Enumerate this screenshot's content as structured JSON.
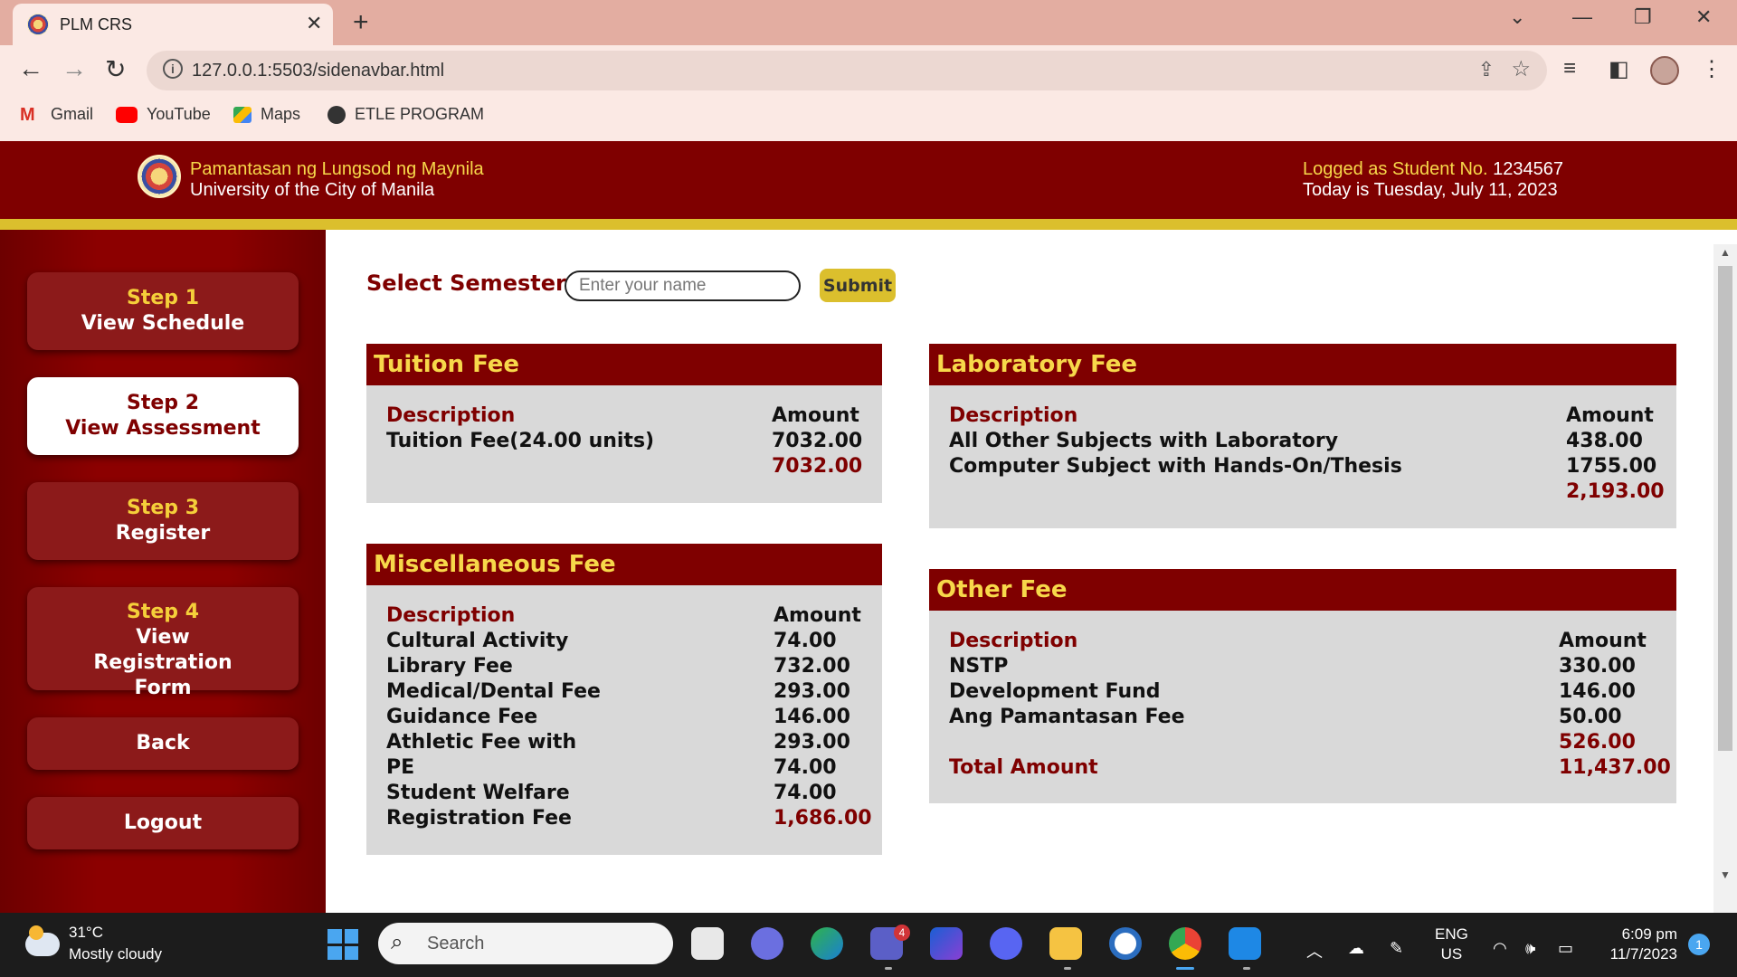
{
  "browser": {
    "tab_title": "PLM CRS",
    "close_glyph": "✕",
    "newtab_glyph": "+",
    "url": "127.0.0.1:5503/sidenavbar.html",
    "bookmarks": [
      {
        "label": "Gmail",
        "icon": "gmail-icon"
      },
      {
        "label": "YouTube",
        "icon": "youtube-icon"
      },
      {
        "label": "Maps",
        "icon": "maps-icon"
      },
      {
        "label": "ETLE PROGRAM",
        "icon": "globe-icon"
      }
    ]
  },
  "header": {
    "university_name": "Pamantasan ng Lungsod ng Maynila",
    "university_subtitle": "University of the City of Manila",
    "logged_prefix": "Logged as Student No.",
    "student_no": "1234567",
    "today_text": "Today is Tuesday, July 11, 2023"
  },
  "sidebar": {
    "steps": [
      {
        "step": "Step 1",
        "label": "View Schedule"
      },
      {
        "step": "Step 2",
        "label": "View Assessment"
      },
      {
        "step": "Step 3",
        "label": "Register"
      },
      {
        "step": "Step 4",
        "label": "View Registration Form"
      }
    ],
    "back": "Back",
    "logout": "Logout"
  },
  "semester": {
    "label": "Select Semester:",
    "placeholder": "Enter your name",
    "value": "",
    "submit": "Submit"
  },
  "fees": {
    "desc_header": "Description",
    "amount_header": "Amount",
    "tuition": {
      "title": "Tuition Fee",
      "rows": [
        {
          "desc": "Tuition Fee(24.00 units)",
          "amount": "7032.00"
        }
      ],
      "subtotal": "7032.00"
    },
    "laboratory": {
      "title": "Laboratory Fee",
      "rows": [
        {
          "desc": "All Other Subjects with Laboratory",
          "amount": "438.00"
        },
        {
          "desc": "Computer Subject with Hands-On/Thesis",
          "amount": "1755.00"
        }
      ],
      "subtotal": "2,193.00"
    },
    "miscellaneous": {
      "title": "Miscellaneous Fee",
      "rows": [
        {
          "desc": "Cultural Activity",
          "amount": "74.00"
        },
        {
          "desc": "Library Fee",
          "amount": "732.00"
        },
        {
          "desc": "Medical/Dental Fee",
          "amount": "293.00"
        },
        {
          "desc": "Guidance Fee",
          "amount": "146.00"
        },
        {
          "desc": "Athletic Fee with",
          "amount": "293.00"
        },
        {
          "desc": "PE",
          "amount": "74.00"
        },
        {
          "desc": "Student Welfare",
          "amount": "74.00"
        }
      ],
      "last_row": {
        "desc": "Registration Fee",
        "amount": "1,686.00"
      }
    },
    "other": {
      "title": "Other Fee",
      "rows": [
        {
          "desc": "NSTP",
          "amount": "330.00"
        },
        {
          "desc": "Development Fund",
          "amount": "146.00"
        },
        {
          "desc": "Ang Pamantasan Fee",
          "amount": "50.00"
        }
      ],
      "subtotal": "526.00",
      "total_label": "Total Amount",
      "total_amount": "11,437.00"
    }
  },
  "taskbar": {
    "temperature": "31°C",
    "condition": "Mostly cloudy",
    "search_placeholder": "Search",
    "lang_line1": "ENG",
    "lang_line2": "US",
    "time": "6:09 pm",
    "date": "11/7/2023",
    "notification_count": "1",
    "teams_badge": "4"
  },
  "colors": {
    "maroon": "#7f0000",
    "gold": "#dbbf2d",
    "header_text_gold": "#f7d84a",
    "card_bg": "#d9d9d9"
  }
}
